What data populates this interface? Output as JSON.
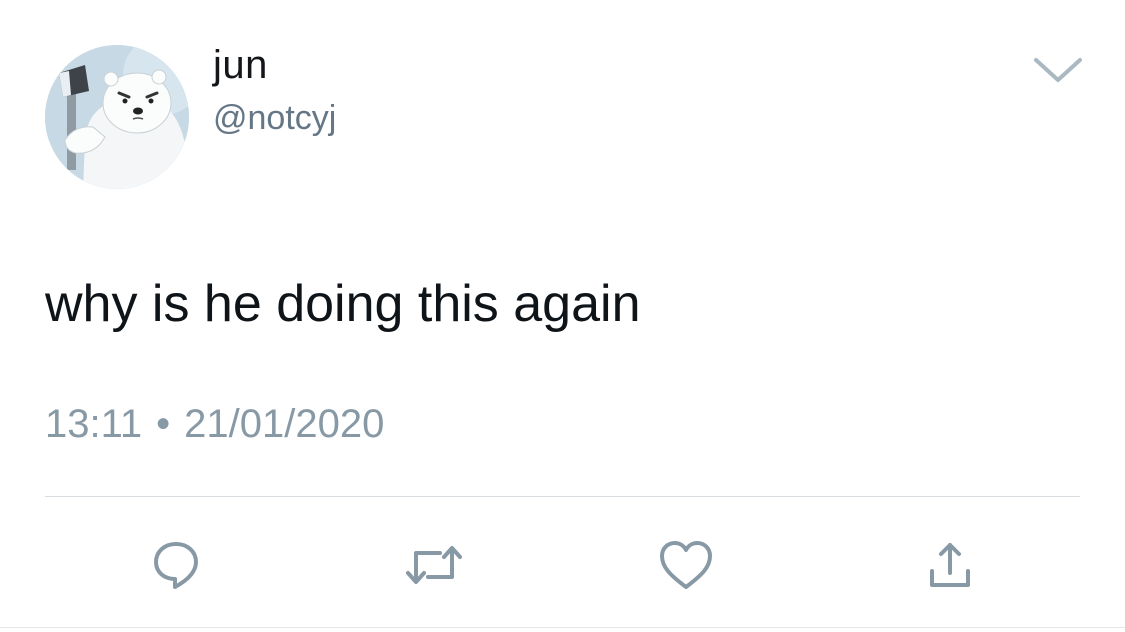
{
  "user": {
    "display_name": "jun",
    "handle": "@notcyj"
  },
  "tweet": {
    "text": "why is he doing this again",
    "time": "13:11",
    "separator": "•",
    "date": "21/01/2020"
  },
  "icons": {
    "menu": "chevron-down-icon",
    "reply": "reply-bubble-icon",
    "retweet": "retweet-icon",
    "like": "heart-icon",
    "share": "share-icon"
  },
  "colors": {
    "name": "#14171a",
    "secondary": "#8899a6",
    "icon": "#8899a6",
    "divider": "#d8dde2"
  }
}
